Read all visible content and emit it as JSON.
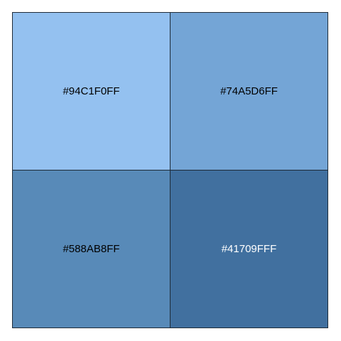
{
  "swatches": [
    {
      "hex_label": "#94C1F0FF",
      "color": "#94C1F0",
      "text_color": "#000000"
    },
    {
      "hex_label": "#74A5D6FF",
      "color": "#74A5D6",
      "text_color": "#000000"
    },
    {
      "hex_label": "#588AB8FF",
      "color": "#588AB8",
      "text_color": "#000000"
    },
    {
      "hex_label": "#41709FFF",
      "color": "#41709F",
      "text_color": "#ffffff"
    }
  ]
}
